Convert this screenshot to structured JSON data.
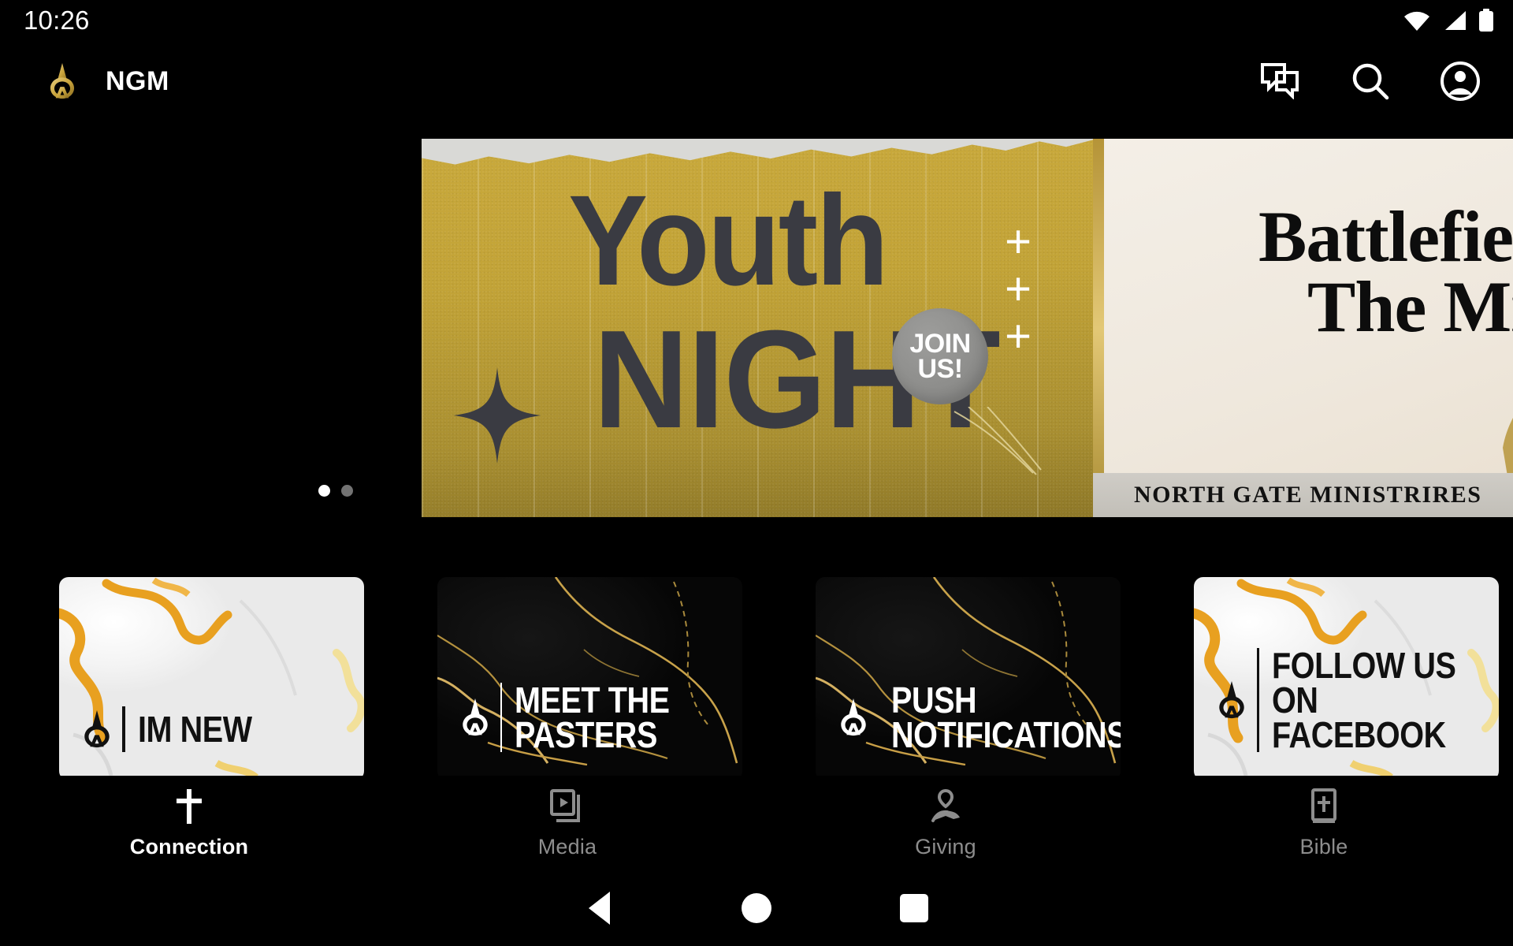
{
  "status_bar": {
    "time": "10:26",
    "icons": [
      "wifi-icon",
      "cellular-signal-icon",
      "battery-icon"
    ]
  },
  "app_bar": {
    "logo_icon": "ngm-spearhead-logo",
    "title": "NGM",
    "actions": [
      {
        "name": "messages-icon",
        "label": "Messages"
      },
      {
        "name": "search-icon",
        "label": "Search"
      },
      {
        "name": "account-icon",
        "label": "Account"
      }
    ]
  },
  "carousel": {
    "active_index": 0,
    "dot_count": 2,
    "slides": [
      {
        "id": "youth-night",
        "line1": "Youth",
        "line2": "NIGHT",
        "badge": {
          "line1": "JOIN",
          "line2": "US!"
        },
        "bg_color": "#c2a337",
        "text_color": "#3a3b42",
        "decorations": [
          "four-point-star-icon",
          "plus-icon",
          "plus-icon",
          "plus-icon",
          "torn-paper-edge"
        ]
      },
      {
        "id": "battlefield-of-the-mind",
        "line1": "Battlefield",
        "line2": "The Mind",
        "footer": "NORTH GATE MINISTRIRES",
        "bg_color": "#efe8dd",
        "accent_color": "#b59438"
      }
    ]
  },
  "tiles": [
    {
      "id": "im-new",
      "label": "IM NEW",
      "style": "light",
      "logo_icon": "ngm-spearhead-logo"
    },
    {
      "id": "meet-the-pasters",
      "label": "MEET THE PASTERS",
      "style": "dark",
      "logo_icon": "ngm-spearhead-logo"
    },
    {
      "id": "push-notifications",
      "label": "PUSH NOTIFICATIONS",
      "style": "dark",
      "logo_icon": "ngm-spearhead-logo"
    },
    {
      "id": "follow-us-on-facebook",
      "label": "FOLLOW US ON\nFACEBOOK",
      "style": "light",
      "logo_icon": "ngm-spearhead-logo"
    }
  ],
  "bottom_nav": {
    "active": "Connection",
    "items": [
      {
        "label": "Connection",
        "icon": "cross-icon",
        "active": true
      },
      {
        "label": "Media",
        "icon": "video-library-icon",
        "active": false
      },
      {
        "label": "Giving",
        "icon": "hand-heart-icon",
        "active": false
      },
      {
        "label": "Bible",
        "icon": "bible-book-icon",
        "active": false
      }
    ]
  },
  "android_nav": {
    "back": "back-triangle-icon",
    "home": "home-circle-icon",
    "recents": "recents-square-icon"
  },
  "colors": {
    "background": "#000000",
    "brand_gold": "#c9a43c",
    "active_text": "#ffffff",
    "inactive_text": "#8d8d8d"
  }
}
